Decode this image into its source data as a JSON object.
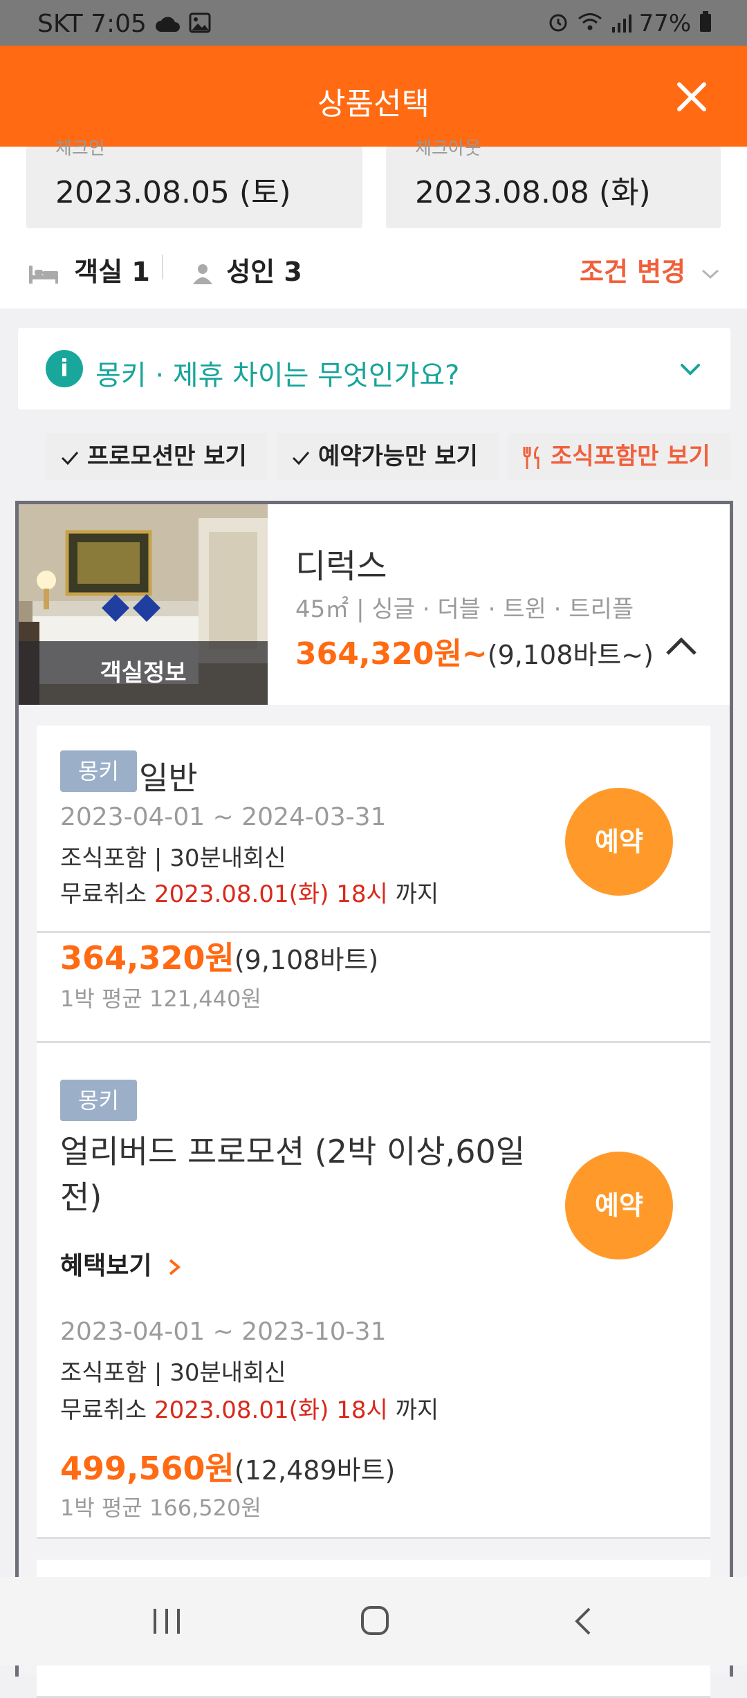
{
  "status_bar": {
    "carrier_time": "SKT  7:05",
    "battery": "77%"
  },
  "header": {
    "title": "상품선택"
  },
  "dates": {
    "checkin_hint": "체크인",
    "checkin": "2023.08.05 (토)",
    "checkout_hint": "체크아웃",
    "checkout": "2023.08.08 (화)"
  },
  "occupancy": {
    "rooms": "객실 1",
    "adults": "성인 3",
    "change_label": "조건 변경"
  },
  "info_banner": {
    "icon": "i",
    "text": "몽키 · 제휴 차이는 무엇인가요?"
  },
  "filters": [
    {
      "label": "프로모션만 보기"
    },
    {
      "label": "예약가능만 보기"
    },
    {
      "label": "조식포함만 보기"
    }
  ],
  "room": {
    "image_label": "객실정보",
    "name": "디럭스",
    "spec": "45㎡ | 싱글 · 더블 · 트윈 · 트리플",
    "price": "364,320원~",
    "price_sub": "(9,108바트~)"
  },
  "plans": [
    {
      "badge": "몽키",
      "name": "일반",
      "period": "2023-04-01 ~ 2024-03-31",
      "inclusions": "조식포함 | 30분내회신",
      "cancel_prefix": "무료취소 ",
      "cancel_date": "2023.08.01(화) 18시",
      "cancel_suffix": " 까지",
      "price": "364,320원",
      "price_sub": "(9,108바트)",
      "avg": "1박 평균 121,440원",
      "book": "예약"
    },
    {
      "badge": "몽키",
      "name_line1": "얼리버드 프로모션 (2박 이상,60일",
      "name_line2": "전)",
      "benefit": "혜택보기",
      "period": "2023-04-01 ~ 2023-10-31",
      "inclusions": "조식포함 | 30분내회신",
      "cancel_prefix": "무료취소 ",
      "cancel_date": "2023.08.01(화) 18시",
      "cancel_suffix": " 까지",
      "price": "499,560원",
      "price_sub": "(12,489바트)",
      "avg": "1박 평균 166,520원",
      "book": "예약"
    }
  ],
  "colors": {
    "accent": "#ff6a12",
    "teal": "#17a59a",
    "red": "#d9281b",
    "book": "#ff9a2a"
  }
}
